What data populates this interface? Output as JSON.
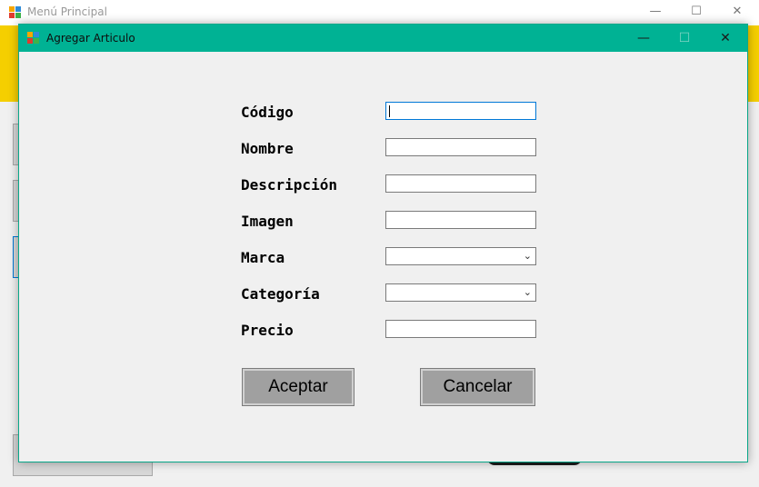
{
  "main_window": {
    "title": "Menú Principal",
    "controls": {
      "minimize": "—",
      "maximize": "☐",
      "close": "✕"
    }
  },
  "dialog": {
    "title": "Agregar Articulo",
    "controls": {
      "minimize": "—",
      "maximize": "☐",
      "close": "✕"
    },
    "fields": {
      "codigo": {
        "label": "Código",
        "value": ""
      },
      "nombre": {
        "label": "Nombre",
        "value": ""
      },
      "descripcion": {
        "label": "Descripción",
        "value": ""
      },
      "imagen": {
        "label": "Imagen",
        "value": ""
      },
      "marca": {
        "label": "Marca",
        "value": ""
      },
      "categoria": {
        "label": "Categoría",
        "value": ""
      },
      "precio": {
        "label": "Precio",
        "value": ""
      }
    },
    "buttons": {
      "accept": "Aceptar",
      "cancel": "Cancelar"
    }
  },
  "colors": {
    "dialog_titlebar": "#00b294",
    "main_accent_band": "#f5cf00",
    "focus_border": "#0078d7",
    "button_face": "#a0a0a0"
  },
  "icons": [
    "app-icon",
    "minimize-icon",
    "maximize-icon",
    "close-icon",
    "chevron-down-icon"
  ]
}
